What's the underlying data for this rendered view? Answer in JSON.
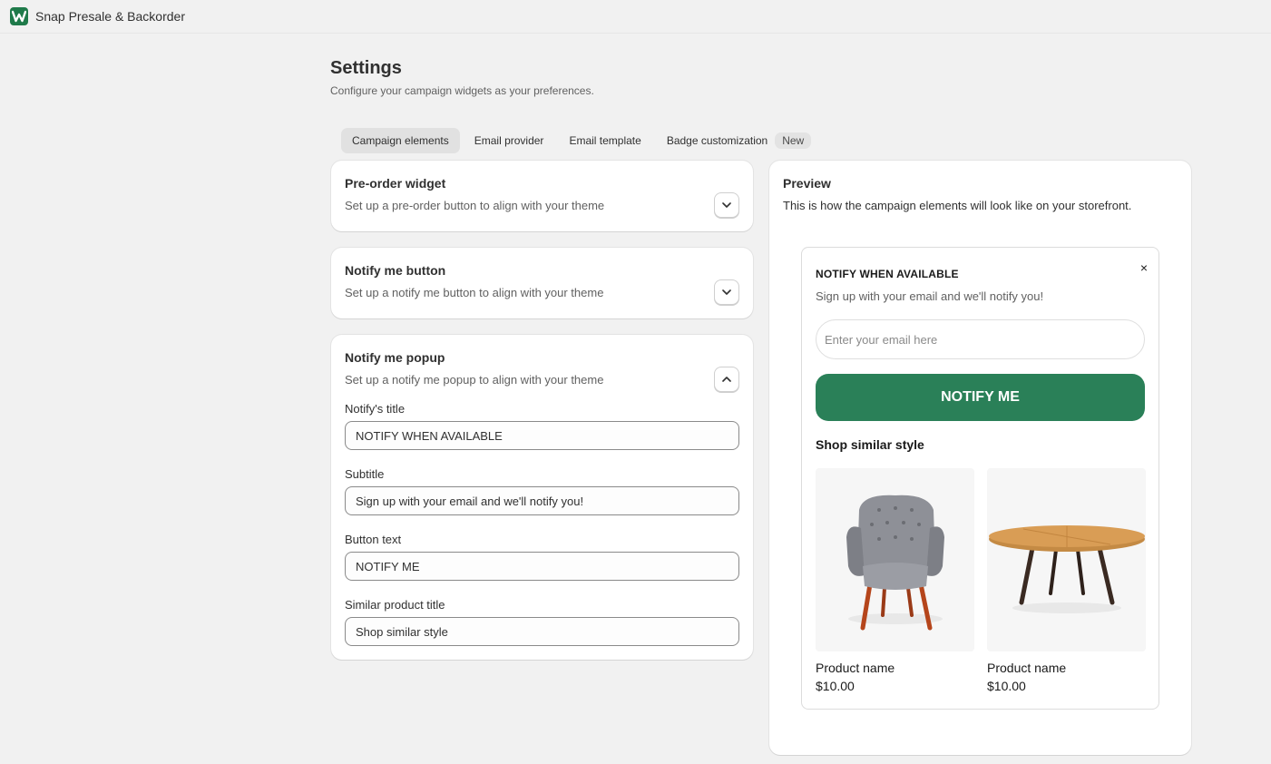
{
  "app": {
    "name": "Snap Presale & Backorder",
    "brand_color": "#1f7a4a"
  },
  "page": {
    "title": "Settings",
    "subtitle": "Configure your campaign widgets as your preferences."
  },
  "tabs": [
    {
      "label": "Campaign elements",
      "active": true
    },
    {
      "label": "Email provider",
      "active": false
    },
    {
      "label": "Email template",
      "active": false
    },
    {
      "label": "Badge customization",
      "active": false,
      "badge": "New"
    }
  ],
  "sections": {
    "preorder": {
      "title": "Pre-order widget",
      "desc": "Set up a pre-order button to align with your theme",
      "icon": "chevron-down-icon"
    },
    "notify_button": {
      "title": "Notify me button",
      "desc": "Set up a notify me button to align with your theme",
      "icon": "chevron-down-icon"
    },
    "notify_popup": {
      "title": "Notify me popup",
      "desc": "Set up a notify me popup to align with your theme",
      "icon": "chevron-up-icon",
      "fields": {
        "title_label": "Notify's title",
        "title_value": "NOTIFY WHEN AVAILABLE",
        "subtitle_label": "Subtitle",
        "subtitle_value": "Sign up with your email and we'll notify you!",
        "button_label": "Button text",
        "button_value": "NOTIFY ME",
        "similar_label": "Similar product title",
        "similar_value": "Shop similar style"
      }
    }
  },
  "preview": {
    "title": "Preview",
    "desc": "This is how the campaign elements will look like on your storefront.",
    "popup": {
      "title": "NOTIFY WHEN AVAILABLE",
      "subtitle": "Sign up with your email and we'll notify you!",
      "close": "×",
      "email_placeholder": "Enter your email here",
      "button": "NOTIFY ME",
      "button_color": "#2a8058",
      "similar_title": "Shop similar style",
      "products": [
        {
          "name": "Product name",
          "price": "$10.00",
          "image": "armchair-image"
        },
        {
          "name": "Product name",
          "price": "$10.00",
          "image": "round-table-image"
        }
      ]
    }
  }
}
